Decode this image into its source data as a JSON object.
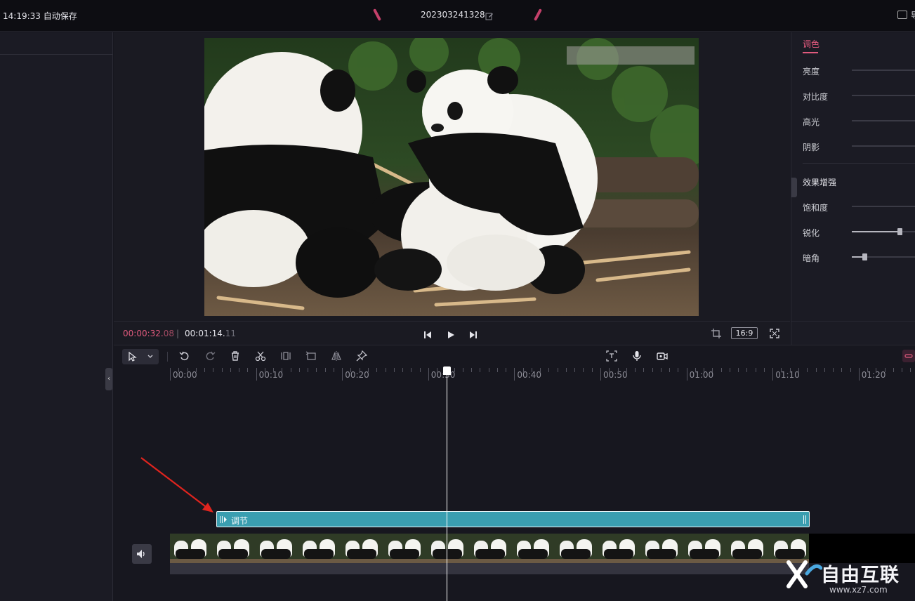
{
  "topbar": {
    "autosave": "14:19:33 自动保存",
    "project_title": "202303241328",
    "right_text": "导"
  },
  "preview": {
    "current_time_main": "00:00:32.",
    "current_time_frames": "08",
    "separator": "|",
    "total_time_main": "00:01:14.",
    "total_time_frames": "11",
    "aspect_ratio": "16:9"
  },
  "adjust_panel": {
    "tab": "调色",
    "basic": [
      {
        "label": "亮度",
        "value": null
      },
      {
        "label": "对比度",
        "value": null
      },
      {
        "label": "高光",
        "value": null
      },
      {
        "label": "阴影",
        "value": null
      }
    ],
    "section_title": "效果增强",
    "enhance": [
      {
        "label": "饱和度",
        "value": null
      },
      {
        "label": "锐化",
        "value": 0.75
      },
      {
        "label": "暗角",
        "value": 0.2
      }
    ]
  },
  "timeline": {
    "ticks": [
      "00:00",
      "00:10",
      "00:20",
      "00:30",
      "00:40",
      "00:50",
      "01:00",
      "01:10",
      "01:20"
    ],
    "adjust_clip_label": "调节",
    "playhead_time": "00:00:32.08"
  },
  "watermark": {
    "main": "自由互联",
    "sub": "www.xz7.com"
  },
  "colors": {
    "accent": "#e05a7d",
    "clip": "#3a9eb0",
    "background": "#17171f"
  }
}
